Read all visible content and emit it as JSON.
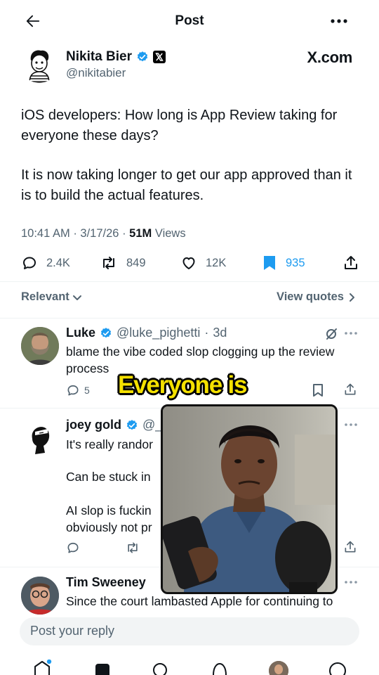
{
  "header": {
    "title": "Post"
  },
  "post": {
    "author_name": "Nikita Bier",
    "author_handle": "@nikitabier",
    "source_label": "X.com",
    "paragraphs": [
      "iOS developers: How long is App Review taking for everyone these days?",
      "It is now taking longer to get our app approved than it is to build the actual features."
    ],
    "time": "10:41 AM",
    "date": "3/17/26",
    "views_count": "51M",
    "views_label": "Views",
    "stats": {
      "replies": "2.4K",
      "reposts": "849",
      "likes": "12K",
      "bookmarks": "935"
    },
    "bookmark_color": "#1d9bf0"
  },
  "filter": {
    "sort_label": "Relevant",
    "quotes_label": "View quotes"
  },
  "replies": [
    {
      "name": "Luke",
      "handle": "@luke_pighetti",
      "age": "3d",
      "line1": "blame the vibe coded slop clogging up the review",
      "line2": "process",
      "reply_count": "5"
    },
    {
      "name": "joey gold",
      "handle": "@_j",
      "line1": "It's really randor",
      "line2": "Can be stuck in",
      "line3": "AI slop is fuckin",
      "line4": "obviously not pr"
    },
    {
      "name": "Tim Sweeney",
      "line1": "Since the court lambasted Apple for continuing to"
    }
  ],
  "caption": {
    "text": "Everyone is"
  },
  "compose": {
    "placeholder": "Post your reply"
  }
}
